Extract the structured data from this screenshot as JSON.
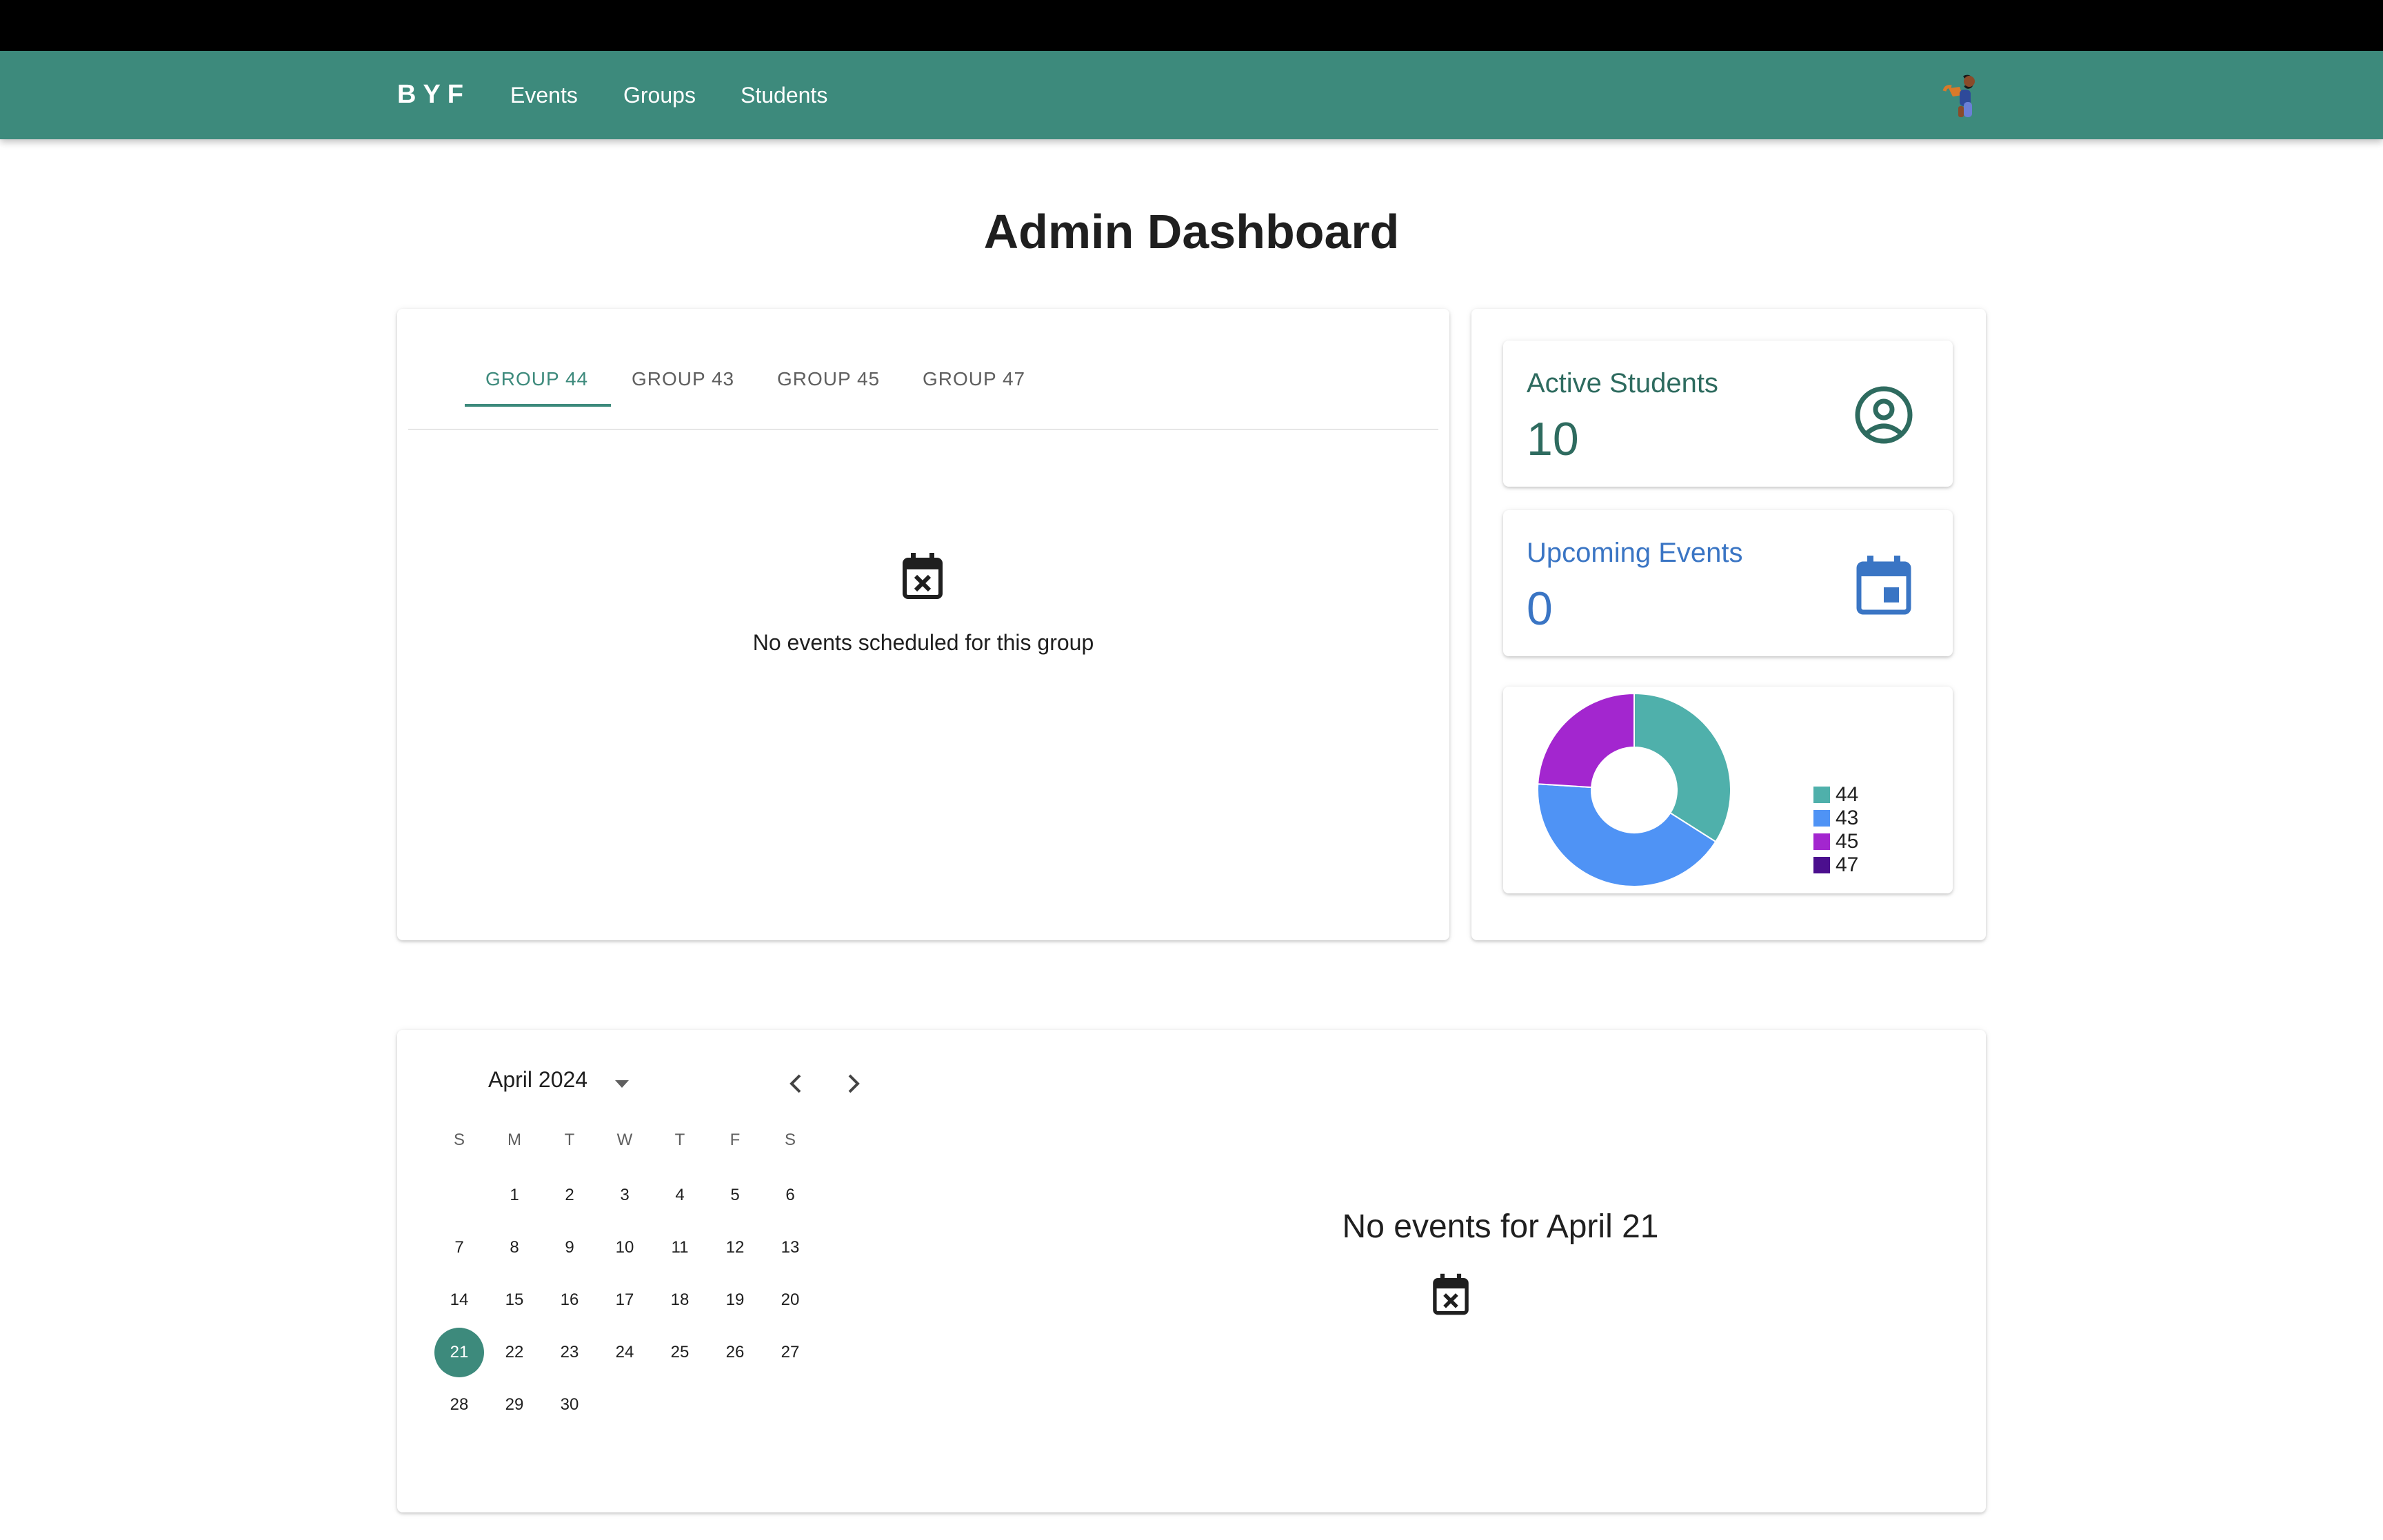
{
  "nav": {
    "brand": "BYF",
    "links": [
      "Events",
      "Groups",
      "Students"
    ]
  },
  "page": {
    "title": "Admin Dashboard"
  },
  "group_tabs": {
    "tabs": [
      "GROUP 44",
      "GROUP 43",
      "GROUP 45",
      "GROUP 47"
    ],
    "active": "GROUP 44",
    "empty_message": "No events scheduled for this group"
  },
  "stats": {
    "active_students": {
      "label": "Active Students",
      "value": "10",
      "color": "#2e6b5f"
    },
    "upcoming_events": {
      "label": "Upcoming Events",
      "value": "0",
      "color": "#3a75c4"
    }
  },
  "chart_data": {
    "type": "pie",
    "categories": [
      "44",
      "43",
      "45",
      "47"
    ],
    "values": [
      34,
      42,
      24,
      0
    ],
    "colors": [
      "#4fb0ab",
      "#4f93f5",
      "#a326cf",
      "#4b0f8e"
    ],
    "legend": "right",
    "donut": true
  },
  "calendar": {
    "month_label": "April 2024",
    "weekdays": [
      "S",
      "M",
      "T",
      "W",
      "T",
      "F",
      "S"
    ],
    "first_weekday_index": 1,
    "days_in_month": 30,
    "selected_day": "21",
    "empty_message": "No events for April 21"
  },
  "colors": {
    "primary": "#3d8a7c",
    "topbar": "#000000"
  },
  "icons": {
    "avatar": "user-avatar-icon",
    "group_empty": "event-busy-icon",
    "active_students": "account-circle-icon",
    "upcoming_events": "event-icon",
    "calendar_prev": "chevron-left-icon",
    "calendar_next": "chevron-right-icon",
    "month_dropdown": "arrow-drop-down-icon"
  }
}
